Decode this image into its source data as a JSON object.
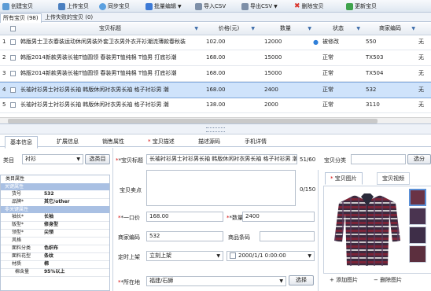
{
  "toolbar": {
    "items": [
      {
        "label": "创建宝贝",
        "icon": "create-item-icon",
        "color": "#5b9bd5"
      },
      {
        "label": "上传宝贝",
        "icon": "upload-icon",
        "color": "#4a7fc0"
      },
      {
        "label": "同步宝贝",
        "icon": "sync-icon",
        "color": "#5aa0e0"
      },
      {
        "label": "批量编辑",
        "icon": "batch-edit-icon",
        "color": "#3d7ad6"
      },
      {
        "label": "导入CSV",
        "icon": "import-csv-icon",
        "color": "#7d8fa8"
      },
      {
        "label": "导出CSV",
        "icon": "export-csv-icon",
        "color": "#7d8fa8"
      },
      {
        "label": "删除宝贝",
        "icon": "delete-icon",
        "color": "#d9342b"
      },
      {
        "label": "更新宝贝",
        "icon": "update-icon",
        "color": "#3fa34d"
      }
    ]
  },
  "list_tabs": [
    "所有宝贝 (98)",
    "上传失败的宝贝 (0)"
  ],
  "grid": {
    "headers": {
      "title": "宝贝标题",
      "price": "价格(元)",
      "qty": "数量",
      "status": "状态",
      "code": "商家编码"
    },
    "rows": [
      {
        "n": "1",
        "title": "韩版男士卫衣春装运动休闲男装外套卫衣男外衣开衫潮流薄款春秋装",
        "price": "102.00",
        "qty": "12000",
        "status": "被修改",
        "code": "550",
        "last": "无"
      },
      {
        "n": "2",
        "title": "韩版2014新款男装长袖T恤圆领 春装男T恤纯棉 T恤男 打底衫潮",
        "price": "168.00",
        "qty": "15000",
        "status": "正常",
        "code": "TX503",
        "last": "无"
      },
      {
        "n": "3",
        "title": "韩版2014新款男装长袖T恤圆领 春装男T恤纯棉 T恤男 打底衫潮",
        "price": "168.00",
        "qty": "15000",
        "status": "正常",
        "code": "TX504",
        "last": "无"
      },
      {
        "n": "4",
        "title": "长袖衬衫男士衬衫男长袖 韩版休闲衬衣男长袖 格子衬衫男 潮",
        "price": "168.00",
        "qty": "2400",
        "status": "正常",
        "code": "532",
        "last": "无"
      },
      {
        "n": "5",
        "title": "长袖衬衫男士衬衫男长袖 韩版休闲衬衣男长袖 格子衬衫男 潮",
        "price": "138.00",
        "qty": "2000",
        "status": "正常",
        "code": "3110",
        "last": "无"
      },
      {
        "n": "6",
        "title": "长袖衬衫男士衬衫男长袖 韩版休闲衬衣男长袖 格子衬衫男 潮",
        "price": "168.00",
        "qty": "1800",
        "status": "正常",
        "code": "CS162",
        "last": "无"
      }
    ]
  },
  "detail_tabs": [
    "基本信息",
    "扩展信息",
    "销售属性",
    "宝贝描述",
    "描述源码",
    "手机详情"
  ],
  "category": {
    "label": "类目",
    "value": "衬衫",
    "button": "选类目"
  },
  "props": {
    "header": "类目属性",
    "sections": {
      "key": "关键属性",
      "nonkey": "非关键属性"
    },
    "key_rows": [
      {
        "k": "货号",
        "v": "532"
      },
      {
        "k": "品牌*",
        "v": "其它/other"
      }
    ],
    "rows": [
      {
        "k": "袖长*",
        "v": "长袖"
      },
      {
        "k": "版型*",
        "v": "修身型"
      },
      {
        "k": "领型*",
        "v": "尖领"
      },
      {
        "k": "风格",
        "v": ""
      },
      {
        "k": "面料分类",
        "v": "色织布"
      },
      {
        "k": "面料花型",
        "v": "条纹"
      },
      {
        "k": "材质",
        "v": "棉"
      },
      {
        "k": "棉含量",
        "v": "95%以上"
      }
    ]
  },
  "form": {
    "title_label": "*宝贝标题",
    "title_value": "长袖衬衫男士衬衫男长袖 韩版休闲衬衣男长袖 格子衬衫男 潮",
    "title_count": "51/60",
    "cat_label": "宝贝分类",
    "cat_button": "选分",
    "selling_label": "宝贝卖点",
    "selling_count": "0/150",
    "price_label": "*一口价",
    "price_value": "168.00",
    "qty_label": "*数量",
    "qty_value": "2400",
    "code_label": "商家编码",
    "code_value": "532",
    "barcode_label": "商品条码",
    "schedule_label": "定时上架",
    "schedule_value": "立刻上架",
    "datetime_value": "2000/1/1 0:00:00",
    "location_label": "*所在地",
    "location_value": "福建/石狮",
    "location_button": "选择"
  },
  "image_panel": {
    "tabs": [
      "宝贝图片",
      "宝贝视频"
    ],
    "add_label": "+ 添加图片",
    "delete_label": "− 删除图片"
  }
}
